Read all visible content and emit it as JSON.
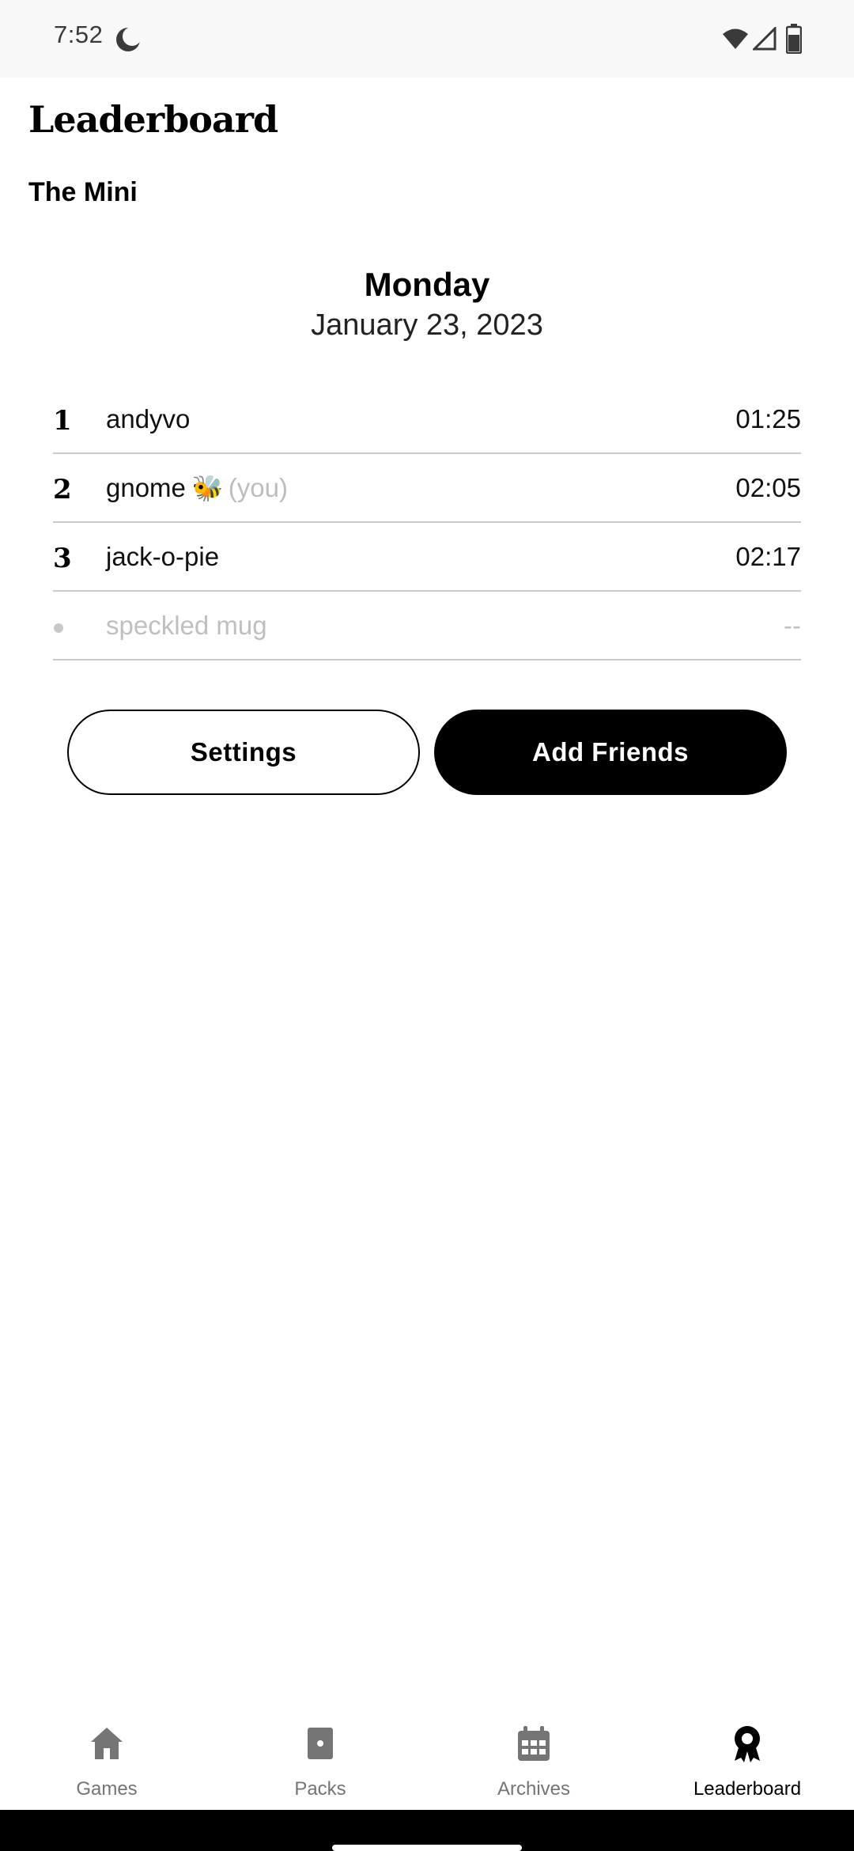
{
  "status_bar": {
    "time": "7:52",
    "icons": [
      "do-not-disturb-icon",
      "wifi-icon",
      "signal-icon",
      "battery-icon"
    ]
  },
  "header": {
    "title": "Leaderboard",
    "subtitle": "The Mini"
  },
  "day_block": {
    "day": "Monday",
    "date": "January 23, 2023"
  },
  "leaderboard": {
    "rows": [
      {
        "rank": "1",
        "name": "andyvo",
        "time": "01:25"
      },
      {
        "rank": "2",
        "name": "gnome",
        "emoji": "🐝",
        "you_tag": "(you)",
        "time": "02:05"
      },
      {
        "rank": "3",
        "name": "jack-o-pie",
        "time": "02:17"
      },
      {
        "rank": "",
        "name": "speckled mug",
        "time": "--"
      }
    ]
  },
  "actions": {
    "settings_label": "Settings",
    "add_friends_label": "Add Friends"
  },
  "nav": {
    "items": [
      {
        "label": "Games",
        "icon": "home-icon",
        "active": false
      },
      {
        "label": "Packs",
        "icon": "pack-icon",
        "active": false
      },
      {
        "label": "Archives",
        "icon": "calendar-icon",
        "active": false
      },
      {
        "label": "Leaderboard",
        "icon": "ribbon-icon",
        "active": true
      }
    ]
  },
  "colors": {
    "primary": "#000000",
    "muted": "#bdbdbd",
    "divider": "#c9c9c9",
    "nav_inactive": "#757575"
  }
}
